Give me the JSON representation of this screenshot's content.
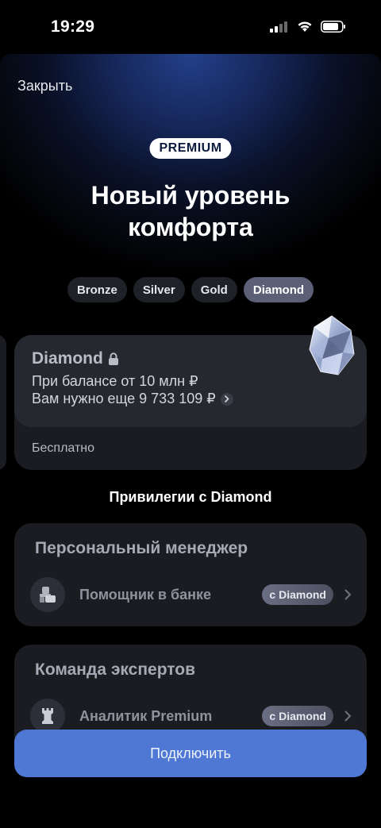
{
  "status": {
    "time": "19:29"
  },
  "header": {
    "close_label": "Закрыть",
    "badge": "PREMIUM",
    "title_line1": "Новый уровень",
    "title_line2": "комфорта"
  },
  "tiers": [
    {
      "label": "Bronze",
      "active": false
    },
    {
      "label": "Silver",
      "active": false
    },
    {
      "label": "Gold",
      "active": false
    },
    {
      "label": "Diamond",
      "active": true
    }
  ],
  "tier_card": {
    "name": "Diamond",
    "condition": "При балансе от 10 млн ₽",
    "remaining": "Вам нужно еще 9 733 109 ₽",
    "price": "Бесплатно"
  },
  "privileges": {
    "title": "Привилегии с Diamond",
    "cards": [
      {
        "heading": "Персональный менеджер",
        "item": "Помощник в банке",
        "tag": "с Diamond",
        "icon": "desk-person-icon"
      },
      {
        "heading": "Команда экспертов",
        "item": "Аналитик Premium",
        "tag": "с Diamond",
        "icon": "chess-rook-icon"
      }
    ]
  },
  "cta": {
    "label": "Подключить"
  },
  "colors": {
    "accent": "#4e78d4",
    "card": "#1a1c22",
    "active_tab": "#5c6076"
  }
}
